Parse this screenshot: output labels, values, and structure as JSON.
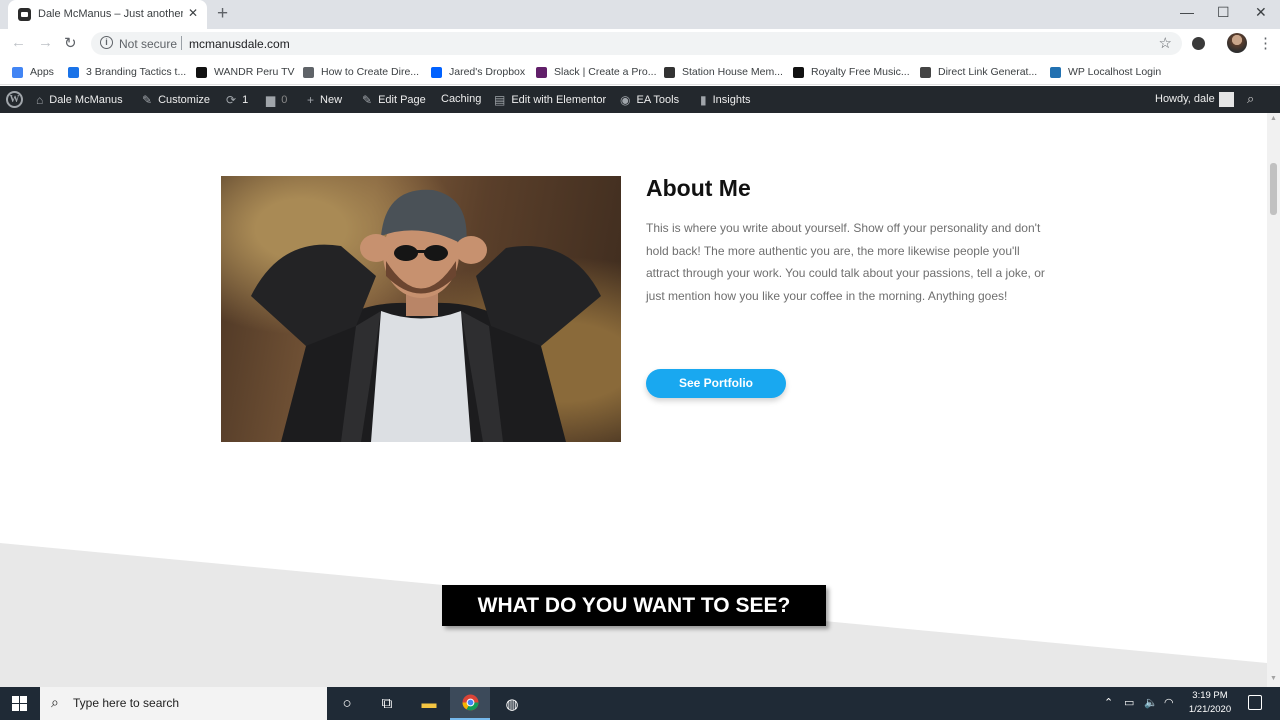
{
  "browser": {
    "tab_title": "Dale McManus – Just another W",
    "tab_close": "✕",
    "new_tab": "+",
    "window_controls": {
      "minimize": "—",
      "maximize": "☐",
      "close": "✕"
    },
    "security_label": "Not secure",
    "url": "mcmanusdale.com",
    "bookmarks": [
      {
        "label": "Apps",
        "icon": "apps-grid-icon",
        "color": "#4285f4"
      },
      {
        "label": "3 Branding Tactics t...",
        "icon": "d-logo-icon",
        "color": "#1a73e8"
      },
      {
        "label": "WANDR Peru TV",
        "icon": "wandr-icon",
        "color": "#111111"
      },
      {
        "label": "How to Create Dire...",
        "icon": "globe-icon",
        "color": "#5f6368"
      },
      {
        "label": "Jared's Dropbox",
        "icon": "dropbox-icon",
        "color": "#0061ff"
      },
      {
        "label": "Slack | Create a Pro...",
        "icon": "slack-icon",
        "color": "#611f69"
      },
      {
        "label": "Station House Mem...",
        "icon": "station-icon",
        "color": "#333333"
      },
      {
        "label": "Royalty Free Music...",
        "icon": "music-icon",
        "color": "#111111"
      },
      {
        "label": "Direct Link Generat...",
        "icon": "link-gen-icon",
        "color": "#444444"
      },
      {
        "label": "WP Localhost Login",
        "icon": "wp-local-icon",
        "color": "#2271b1"
      }
    ]
  },
  "wp_admin_bar": {
    "site_name": "Dale McManus",
    "customize": "Customize",
    "updates_count": "1",
    "comments_count": "0",
    "new": "New",
    "edit_page": "Edit Page",
    "caching": "Caching",
    "edit_elementor": "Edit with Elementor",
    "ea_tools": "EA Tools",
    "insights": "Insights",
    "howdy": "Howdy, dale"
  },
  "page": {
    "about_title": "About Me",
    "about_text": "This is where you write about yourself. Show off your personality and don't hold back! The more authentic you are, the more likewise people you'll attract through your work. You could talk about your passions, tell a joke, or just mention how you like your coffee in the morning. Anything goes!",
    "cta_label": "See Portfolio",
    "cta_color": "#19a8f0",
    "caption": "WHAT DO YOU WANT TO SEE?"
  },
  "taskbar": {
    "search_placeholder": "Type here to search",
    "time": "3:19 PM",
    "date": "1/21/2020"
  }
}
